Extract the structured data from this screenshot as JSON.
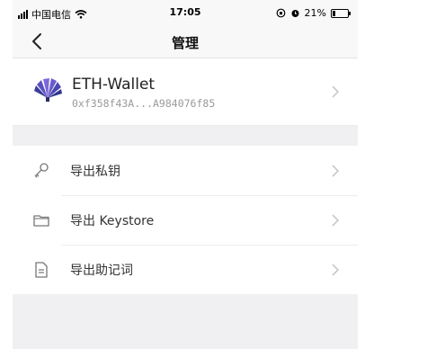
{
  "status_bar": {
    "carrier": "中国电信",
    "time": "17:05",
    "battery_text": "21%",
    "battery_level": 0.21
  },
  "nav": {
    "title": "管理"
  },
  "wallet": {
    "name": "ETH-Wallet",
    "address": "0xf358f43A...A984076f85"
  },
  "menu": {
    "items": [
      {
        "label": "导出私钥",
        "icon": "key-icon"
      },
      {
        "label": "导出 Keystore",
        "icon": "folder-icon"
      },
      {
        "label": "导出助记词",
        "icon": "document-icon"
      }
    ]
  }
}
